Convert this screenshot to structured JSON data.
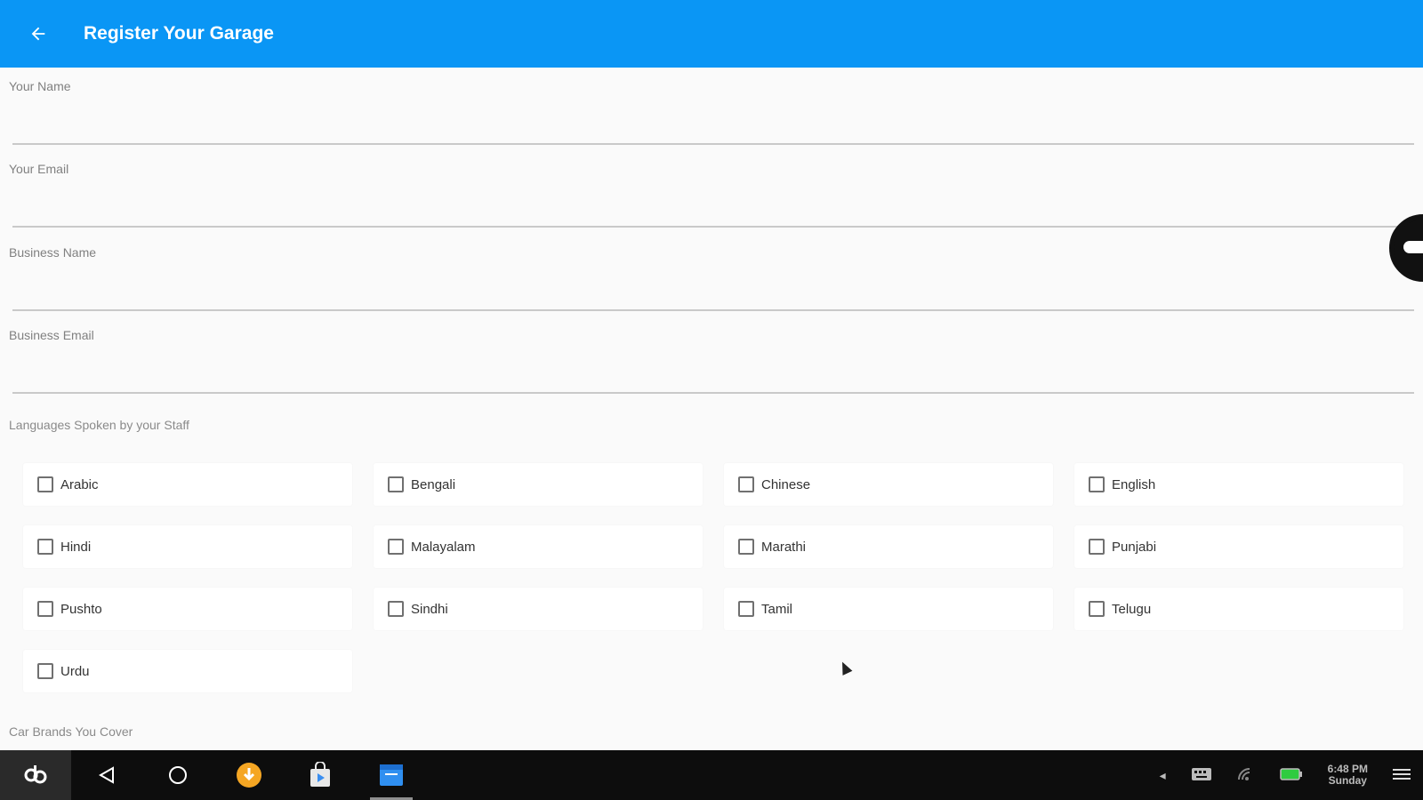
{
  "appbar": {
    "title": "Register Your Garage"
  },
  "fields": [
    {
      "label": "Your Name",
      "value": ""
    },
    {
      "label": "Your Email",
      "value": ""
    },
    {
      "label": "Business Name",
      "value": ""
    },
    {
      "label": "Business Email",
      "value": ""
    }
  ],
  "languages": {
    "label": "Languages Spoken by your Staff",
    "items": [
      "Arabic",
      "Bengali",
      "Chinese",
      "English",
      "Hindi",
      "Malayalam",
      "Marathi",
      "Punjabi",
      "Pushto",
      "Sindhi",
      "Tamil",
      "Telugu",
      "Urdu"
    ]
  },
  "brands": {
    "label": "Car Brands You Cover"
  },
  "taskbar": {
    "clock_time": "6:48 PM",
    "clock_day": "Sunday"
  },
  "colors": {
    "appbar": "#0a96f5",
    "taskbar": "#0d0d0d"
  }
}
